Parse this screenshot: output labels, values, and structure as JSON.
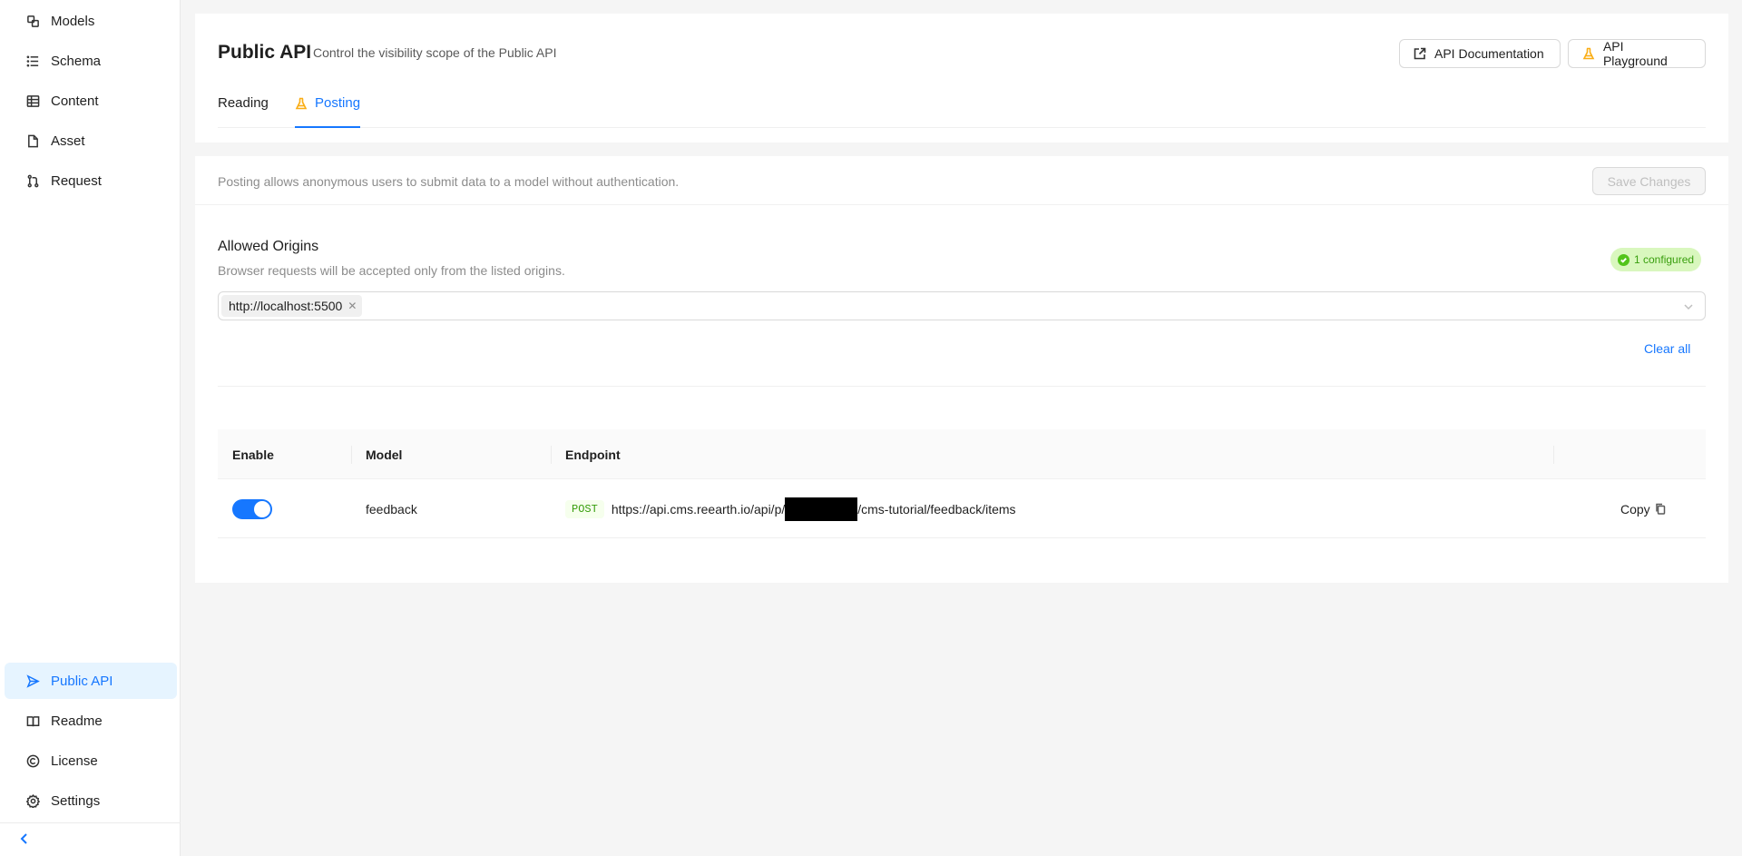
{
  "sidebar": {
    "items": [
      {
        "label": "Models",
        "icon": "models-icon"
      },
      {
        "label": "Schema",
        "icon": "schema-icon"
      },
      {
        "label": "Content",
        "icon": "content-icon"
      },
      {
        "label": "Asset",
        "icon": "asset-icon"
      },
      {
        "label": "Request",
        "icon": "request-icon"
      }
    ],
    "bottom_items": [
      {
        "label": "Public API",
        "icon": "public-api-icon",
        "active": true
      },
      {
        "label": "Readme",
        "icon": "readme-icon"
      },
      {
        "label": "License",
        "icon": "license-icon"
      },
      {
        "label": "Settings",
        "icon": "settings-icon"
      }
    ],
    "collapse_icon": "chevron-left-icon"
  },
  "header": {
    "title": "Public API",
    "subtitle": "Control the visibility scope of the Public API",
    "doc_button": "API Documentation",
    "playground_button": "API Playground",
    "tabs": [
      {
        "label": "Reading"
      },
      {
        "label": "Posting",
        "active": true
      }
    ]
  },
  "posting": {
    "info": "Posting allows anonymous users to submit data to a model without authentication.",
    "save_button": "Save Changes",
    "origins": {
      "title": "Allowed Origins",
      "description": "Browser requests will be accepted only from the listed origins.",
      "badge": "1 configured",
      "tags": [
        "http://localhost:5500"
      ],
      "clear_all": "Clear all"
    },
    "table": {
      "headers": {
        "enable": "Enable",
        "model": "Model",
        "endpoint": "Endpoint"
      },
      "rows": [
        {
          "enabled": true,
          "model": "feedback",
          "method": "POST",
          "endpoint_prefix": "https://api.cms.reearth.io/api/p/",
          "endpoint_suffix": "/cms-tutorial/feedback/items",
          "copy_label": "Copy"
        }
      ]
    }
  },
  "colors": {
    "accent": "#1677ff",
    "success_bg": "#d9f7be",
    "success_text": "#389e0d",
    "playground_icon": "#faad14"
  }
}
